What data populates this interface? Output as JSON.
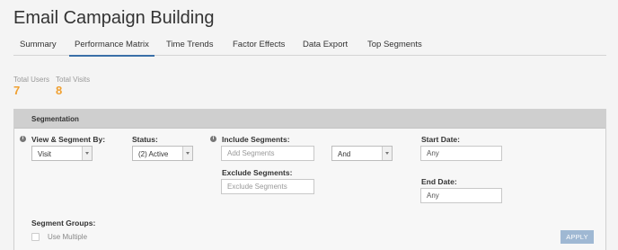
{
  "page": {
    "title": "Email Campaign Building"
  },
  "tabs": [
    {
      "label": "Summary",
      "active": false
    },
    {
      "label": "Performance Matrix",
      "active": true
    },
    {
      "label": "Time Trends",
      "active": false
    },
    {
      "label": "Factor Effects",
      "active": false
    },
    {
      "label": "Data Export",
      "active": false
    },
    {
      "label": "Top Segments",
      "active": false
    }
  ],
  "stats": {
    "total_users": {
      "label": "Total Users",
      "value": "7"
    },
    "total_visits": {
      "label": "Total Visits",
      "value": "8"
    }
  },
  "segmentation": {
    "title": "Segmentation",
    "view_segment_by": {
      "label": "View & Segment By:",
      "value": "Visit"
    },
    "status": {
      "label": "Status:",
      "value": "(2) Active"
    },
    "include_segments": {
      "label": "Include Segments:",
      "placeholder": "Add Segments"
    },
    "logic": {
      "value": "And"
    },
    "exclude_segments": {
      "label": "Exclude Segments:",
      "placeholder": "Exclude Segments"
    },
    "start_date": {
      "label": "Start Date:",
      "value": "Any"
    },
    "end_date": {
      "label": "End Date:",
      "value": "Any"
    },
    "segment_groups": {
      "label": "Segment Groups:",
      "checkbox_label": "Use Multiple"
    },
    "apply_label": "APPLY",
    "info_glyph": "i"
  },
  "colors": {
    "accent": "#3a6fa8",
    "stat_value": "#f0a030",
    "apply_button": "#9fb8d3",
    "header_bar": "#cfcfcf"
  }
}
